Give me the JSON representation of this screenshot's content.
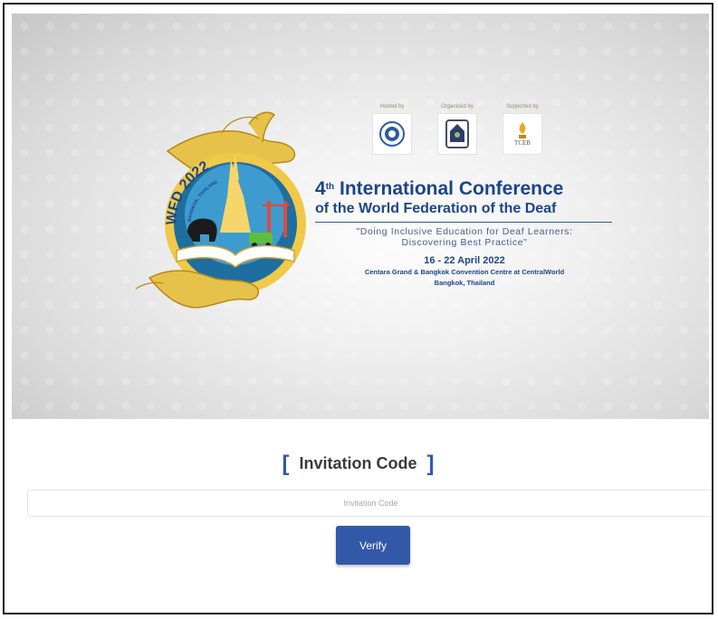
{
  "banner": {
    "logo_text": "WFD 2022",
    "logo_subtext": "BANGKOK, THAILAND",
    "sponsors": [
      {
        "label": "Hosted by",
        "icon": "un-emblem-icon"
      },
      {
        "label": "Organized by",
        "icon": "organizer-seal-icon"
      },
      {
        "label": "Supported by",
        "icon": "tceb-logo-icon",
        "logo_text": "TCEB"
      }
    ],
    "title_ordinal": "4",
    "title_suffix": "th",
    "title_main": "International Conference",
    "title_sub": "of the World Federation of the Deaf",
    "quote_line1": "\"Doing Inclusive Education for Deaf Learners:",
    "quote_line2": "Discovering Best Practice\"",
    "dates": "16 - 22 April 2022",
    "venue_line1": "Centara Grand & Bangkok Convention Centre at CentralWorld",
    "venue_line2": "Bangkok, Thailand"
  },
  "form": {
    "bracket_open": "[",
    "heading": "Invitation Code",
    "bracket_close": "]",
    "input_placeholder": "Invitation Code",
    "input_value": "",
    "verify_label": "Verify"
  },
  "colors": {
    "accent": "#3258a8",
    "title_blue": "#1d4586",
    "gold": "#e7c24a"
  }
}
